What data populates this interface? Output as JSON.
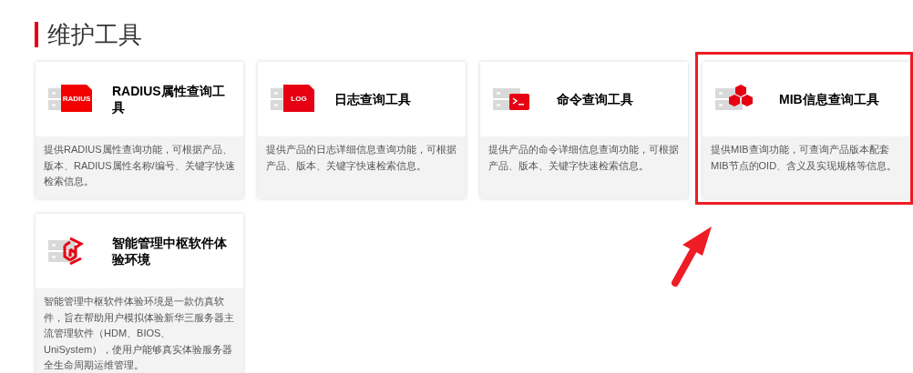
{
  "section": {
    "title": "维护工具"
  },
  "cards": [
    {
      "kind": "radius",
      "icon_text": "RADIUS",
      "title": "RADIUS属性查询工具",
      "description": "提供RADIUS属性查询功能，可根据产品、版本、RADIUS属性名称/编号、关键字快速检索信息。",
      "highlighted": false
    },
    {
      "kind": "log",
      "icon_text": "LOG",
      "title": "日志查询工具",
      "description": "提供产品的日志详细信息查询功能，可根据产品、版本、关键字快速检索信息。",
      "highlighted": false
    },
    {
      "kind": "terminal",
      "title": "命令查询工具",
      "description": "提供产品的命令详细信息查询功能，可根据产品、版本、关键字快速检索信息。",
      "highlighted": false
    },
    {
      "kind": "cubes",
      "title": "MIB信息查询工具",
      "description": "提供MIB查询功能，可查询产品版本配套MIB节点的OID、含义及实现规格等信息。",
      "highlighted": true
    },
    {
      "kind": "hexagon",
      "title": "智能管理中枢软件体验环境",
      "description": "智能管理中枢软件体验环境是一款仿真软件，旨在帮助用户模拟体验新华三服务器主流管理软件（HDM、BIOS、UniSystem），使用户能够真实体验服务器全生命周期运维管理。",
      "highlighted": false
    }
  ]
}
